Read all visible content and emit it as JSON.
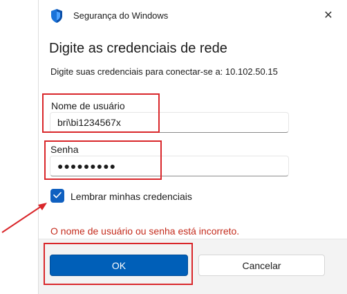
{
  "window": {
    "title": "Segurança do Windows",
    "close_glyph": "✕"
  },
  "dialog": {
    "heading": "Digite as credenciais de rede",
    "instruction": "Digite suas credenciais para conectar-se a: 10.102.50.15"
  },
  "username": {
    "label": "Nome de usuário",
    "value": "bri\\bi1234567x"
  },
  "password": {
    "label": "Senha",
    "value": "●●●●●●●●●"
  },
  "remember": {
    "label": "Lembrar minhas credenciais",
    "checked": true
  },
  "error": {
    "message": "O nome de usuário ou senha está incorreto."
  },
  "buttons": {
    "ok": "OK",
    "cancel": "Cancelar"
  },
  "colors": {
    "accent": "#005fb8",
    "error": "#c42b1c",
    "annotation": "#d9262a"
  },
  "icons": {
    "title_icon": "windows-security-shield-icon",
    "checkbox_icon": "checkmark-icon"
  }
}
